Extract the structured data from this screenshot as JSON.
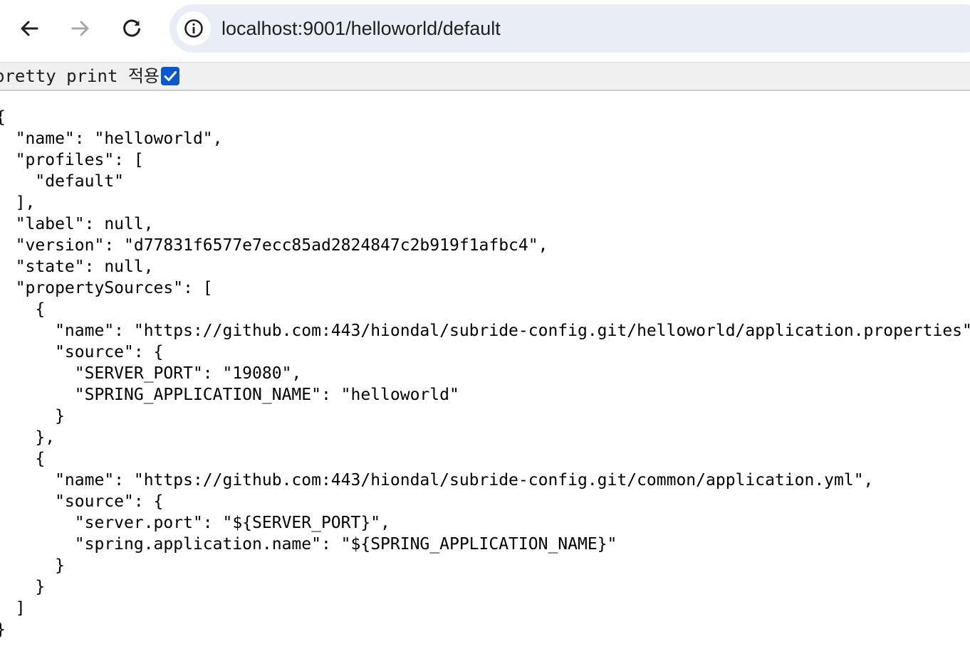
{
  "browser": {
    "url": "localhost:9001/helloworld/default",
    "back_icon": "arrow-left-icon",
    "forward_icon": "arrow-right-icon",
    "reload_icon": "reload-icon",
    "site_info_icon": "info-icon"
  },
  "pretty_print": {
    "label": "pretty print 적용",
    "checked": true,
    "accent_color": "#0b57d0"
  },
  "json_body": "{\n  \"name\": \"helloworld\",\n  \"profiles\": [\n    \"default\"\n  ],\n  \"label\": null,\n  \"version\": \"d77831f6577e7ecc85ad2824847c2b919f1afbc4\",\n  \"state\": null,\n  \"propertySources\": [\n    {\n      \"name\": \"https://github.com:443/hiondal/subride-config.git/helloworld/application.properties\",\n      \"source\": {\n        \"SERVER_PORT\": \"19080\",\n        \"SPRING_APPLICATION_NAME\": \"helloworld\"\n      }\n    },\n    {\n      \"name\": \"https://github.com:443/hiondal/subride-config.git/common/application.yml\",\n      \"source\": {\n        \"server.port\": \"${SERVER_PORT}\",\n        \"spring.application.name\": \"${SPRING_APPLICATION_NAME}\"\n      }\n    }\n  ]\n}"
}
